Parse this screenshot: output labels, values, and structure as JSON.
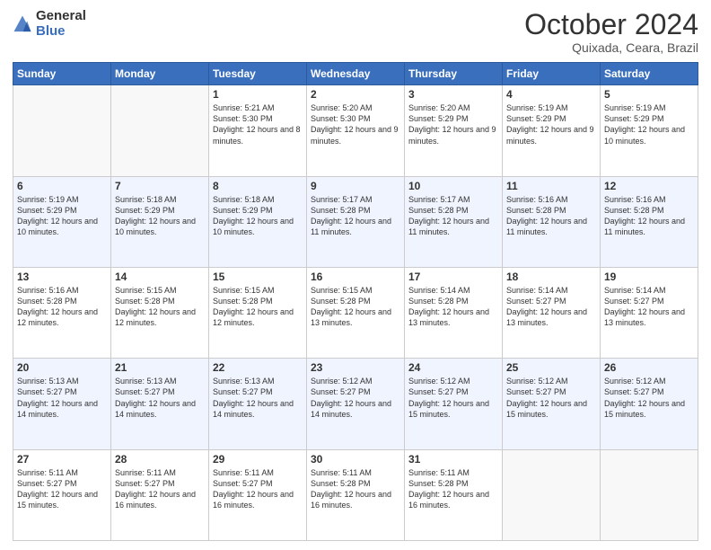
{
  "header": {
    "logo_general": "General",
    "logo_blue": "Blue",
    "title": "October 2024",
    "location": "Quixada, Ceara, Brazil"
  },
  "days_of_week": [
    "Sunday",
    "Monday",
    "Tuesday",
    "Wednesday",
    "Thursday",
    "Friday",
    "Saturday"
  ],
  "weeks": [
    [
      {
        "day": "",
        "info": ""
      },
      {
        "day": "",
        "info": ""
      },
      {
        "day": "1",
        "info": "Sunrise: 5:21 AM\nSunset: 5:30 PM\nDaylight: 12 hours and 8 minutes."
      },
      {
        "day": "2",
        "info": "Sunrise: 5:20 AM\nSunset: 5:30 PM\nDaylight: 12 hours and 9 minutes."
      },
      {
        "day": "3",
        "info": "Sunrise: 5:20 AM\nSunset: 5:29 PM\nDaylight: 12 hours and 9 minutes."
      },
      {
        "day": "4",
        "info": "Sunrise: 5:19 AM\nSunset: 5:29 PM\nDaylight: 12 hours and 9 minutes."
      },
      {
        "day": "5",
        "info": "Sunrise: 5:19 AM\nSunset: 5:29 PM\nDaylight: 12 hours and 10 minutes."
      }
    ],
    [
      {
        "day": "6",
        "info": "Sunrise: 5:19 AM\nSunset: 5:29 PM\nDaylight: 12 hours and 10 minutes."
      },
      {
        "day": "7",
        "info": "Sunrise: 5:18 AM\nSunset: 5:29 PM\nDaylight: 12 hours and 10 minutes."
      },
      {
        "day": "8",
        "info": "Sunrise: 5:18 AM\nSunset: 5:29 PM\nDaylight: 12 hours and 10 minutes."
      },
      {
        "day": "9",
        "info": "Sunrise: 5:17 AM\nSunset: 5:28 PM\nDaylight: 12 hours and 11 minutes."
      },
      {
        "day": "10",
        "info": "Sunrise: 5:17 AM\nSunset: 5:28 PM\nDaylight: 12 hours and 11 minutes."
      },
      {
        "day": "11",
        "info": "Sunrise: 5:16 AM\nSunset: 5:28 PM\nDaylight: 12 hours and 11 minutes."
      },
      {
        "day": "12",
        "info": "Sunrise: 5:16 AM\nSunset: 5:28 PM\nDaylight: 12 hours and 11 minutes."
      }
    ],
    [
      {
        "day": "13",
        "info": "Sunrise: 5:16 AM\nSunset: 5:28 PM\nDaylight: 12 hours and 12 minutes."
      },
      {
        "day": "14",
        "info": "Sunrise: 5:15 AM\nSunset: 5:28 PM\nDaylight: 12 hours and 12 minutes."
      },
      {
        "day": "15",
        "info": "Sunrise: 5:15 AM\nSunset: 5:28 PM\nDaylight: 12 hours and 12 minutes."
      },
      {
        "day": "16",
        "info": "Sunrise: 5:15 AM\nSunset: 5:28 PM\nDaylight: 12 hours and 13 minutes."
      },
      {
        "day": "17",
        "info": "Sunrise: 5:14 AM\nSunset: 5:28 PM\nDaylight: 12 hours and 13 minutes."
      },
      {
        "day": "18",
        "info": "Sunrise: 5:14 AM\nSunset: 5:27 PM\nDaylight: 12 hours and 13 minutes."
      },
      {
        "day": "19",
        "info": "Sunrise: 5:14 AM\nSunset: 5:27 PM\nDaylight: 12 hours and 13 minutes."
      }
    ],
    [
      {
        "day": "20",
        "info": "Sunrise: 5:13 AM\nSunset: 5:27 PM\nDaylight: 12 hours and 14 minutes."
      },
      {
        "day": "21",
        "info": "Sunrise: 5:13 AM\nSunset: 5:27 PM\nDaylight: 12 hours and 14 minutes."
      },
      {
        "day": "22",
        "info": "Sunrise: 5:13 AM\nSunset: 5:27 PM\nDaylight: 12 hours and 14 minutes."
      },
      {
        "day": "23",
        "info": "Sunrise: 5:12 AM\nSunset: 5:27 PM\nDaylight: 12 hours and 14 minutes."
      },
      {
        "day": "24",
        "info": "Sunrise: 5:12 AM\nSunset: 5:27 PM\nDaylight: 12 hours and 15 minutes."
      },
      {
        "day": "25",
        "info": "Sunrise: 5:12 AM\nSunset: 5:27 PM\nDaylight: 12 hours and 15 minutes."
      },
      {
        "day": "26",
        "info": "Sunrise: 5:12 AM\nSunset: 5:27 PM\nDaylight: 12 hours and 15 minutes."
      }
    ],
    [
      {
        "day": "27",
        "info": "Sunrise: 5:11 AM\nSunset: 5:27 PM\nDaylight: 12 hours and 15 minutes."
      },
      {
        "day": "28",
        "info": "Sunrise: 5:11 AM\nSunset: 5:27 PM\nDaylight: 12 hours and 16 minutes."
      },
      {
        "day": "29",
        "info": "Sunrise: 5:11 AM\nSunset: 5:27 PM\nDaylight: 12 hours and 16 minutes."
      },
      {
        "day": "30",
        "info": "Sunrise: 5:11 AM\nSunset: 5:28 PM\nDaylight: 12 hours and 16 minutes."
      },
      {
        "day": "31",
        "info": "Sunrise: 5:11 AM\nSunset: 5:28 PM\nDaylight: 12 hours and 16 minutes."
      },
      {
        "day": "",
        "info": ""
      },
      {
        "day": "",
        "info": ""
      }
    ]
  ]
}
